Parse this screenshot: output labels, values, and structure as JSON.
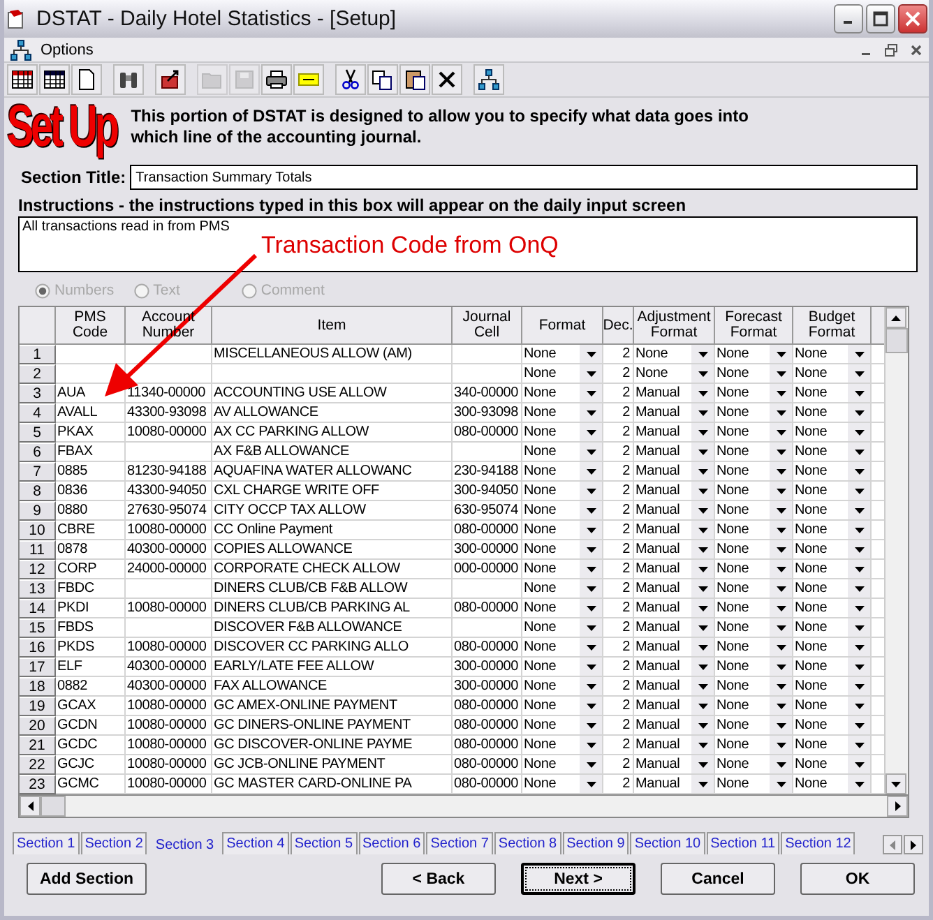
{
  "window": {
    "title": "DSTAT - Daily Hotel Statistics - [Setup]"
  },
  "menu": {
    "label": "Options"
  },
  "toolbar": [
    {
      "kind": "grid-red",
      "disabled": false
    },
    {
      "kind": "grid",
      "disabled": false
    },
    {
      "kind": "page",
      "disabled": false
    },
    {
      "kind": "separator"
    },
    {
      "kind": "binoculars",
      "disabled": false
    },
    {
      "kind": "separator"
    },
    {
      "kind": "export",
      "disabled": false
    },
    {
      "kind": "separator"
    },
    {
      "kind": "folder",
      "disabled": true
    },
    {
      "kind": "save",
      "disabled": true
    },
    {
      "kind": "print",
      "disabled": false
    },
    {
      "kind": "note",
      "disabled": false
    },
    {
      "kind": "separator"
    },
    {
      "kind": "cut",
      "disabled": false
    },
    {
      "kind": "copy",
      "disabled": false
    },
    {
      "kind": "paste",
      "disabled": false
    },
    {
      "kind": "delete",
      "disabled": false
    },
    {
      "kind": "separator"
    },
    {
      "kind": "tree",
      "disabled": false
    }
  ],
  "banner": {
    "logo": "Set Up",
    "text": "This portion of DSTAT is designed to allow you to specify what data goes into which line of the accounting journal."
  },
  "section_title": {
    "label": "Section Title:",
    "value": "Transaction Summary Totals"
  },
  "instructions": {
    "label": "Instructions - the instructions typed in this box will appear on the daily input screen",
    "value": "All transactions read in from PMS"
  },
  "annotation": {
    "text": "Transaction Code from OnQ"
  },
  "value_types": [
    {
      "label": "Numbers",
      "selected": true,
      "disabled": true
    },
    {
      "label": "Text",
      "selected": false,
      "disabled": true
    },
    {
      "label": "Comment",
      "selected": false,
      "disabled": true
    }
  ],
  "table": {
    "columns": [
      {
        "label": "PMS Code",
        "kind": "text"
      },
      {
        "label": "Account Number",
        "kind": "text"
      },
      {
        "label": "Item",
        "kind": "text"
      },
      {
        "label": "Journal Cell",
        "kind": "text"
      },
      {
        "label": "Format",
        "kind": "dropdown"
      },
      {
        "label": "Dec.",
        "kind": "number"
      },
      {
        "label": "Adjustment Format",
        "kind": "dropdown"
      },
      {
        "label": "Forecast Format",
        "kind": "dropdown"
      },
      {
        "label": "Budget Format",
        "kind": "dropdown"
      }
    ],
    "rows": [
      {
        "number": "1",
        "cells": [
          null,
          null,
          "MISCELLANEOUS ALLOW (AM)",
          null,
          "None",
          "2",
          "None",
          "None",
          "None"
        ]
      },
      {
        "number": "2",
        "cells": [
          null,
          null,
          null,
          null,
          "None",
          "2",
          "None",
          "None",
          "None"
        ]
      },
      {
        "number": "3",
        "cells": [
          "AUA",
          "11340-00000",
          "ACCOUNTING USE ALLOW",
          "340-00000",
          "None",
          "2",
          "Manual",
          "None",
          "None"
        ]
      },
      {
        "number": "4",
        "cells": [
          "AVALL",
          "43300-93098",
          "AV ALLOWANCE",
          "300-93098",
          "None",
          "2",
          "Manual",
          "None",
          "None"
        ]
      },
      {
        "number": "5",
        "cells": [
          "PKAX",
          "10080-00000",
          "AX CC PARKING ALLOW",
          "080-00000",
          "None",
          "2",
          "Manual",
          "None",
          "None"
        ]
      },
      {
        "number": "6",
        "cells": [
          "FBAX",
          null,
          "AX F&B ALLOWANCE",
          null,
          "None",
          "2",
          "Manual",
          "None",
          "None"
        ]
      },
      {
        "number": "7",
        "cells": [
          "0885",
          "81230-94188",
          "AQUAFINA WATER ALLOWANC",
          "230-94188",
          "None",
          "2",
          "Manual",
          "None",
          "None"
        ]
      },
      {
        "number": "8",
        "cells": [
          "0836",
          "43300-94050",
          "CXL CHARGE WRITE OFF",
          "300-94050",
          "None",
          "2",
          "Manual",
          "None",
          "None"
        ]
      },
      {
        "number": "9",
        "cells": [
          "0880",
          "27630-95074",
          "CITY OCCP TAX ALLOW",
          "630-95074",
          "None",
          "2",
          "Manual",
          "None",
          "None"
        ]
      },
      {
        "number": "10",
        "cells": [
          "CBRE",
          "10080-00000",
          "CC Online Payment",
          "080-00000",
          "None",
          "2",
          "Manual",
          "None",
          "None"
        ]
      },
      {
        "number": "11",
        "cells": [
          "0878",
          "40300-00000",
          "COPIES ALLOWANCE",
          "300-00000",
          "None",
          "2",
          "Manual",
          "None",
          "None"
        ]
      },
      {
        "number": "12",
        "cells": [
          "CORP",
          "24000-00000",
          "CORPORATE CHECK ALLOW",
          "000-00000",
          "None",
          "2",
          "Manual",
          "None",
          "None"
        ]
      },
      {
        "number": "13",
        "cells": [
          "FBDC",
          null,
          "DINERS CLUB/CB F&B ALLOW",
          null,
          "None",
          "2",
          "Manual",
          "None",
          "None"
        ]
      },
      {
        "number": "14",
        "cells": [
          "PKDI",
          "10080-00000",
          "DINERS CLUB/CB PARKING AL",
          "080-00000",
          "None",
          "2",
          "Manual",
          "None",
          "None"
        ]
      },
      {
        "number": "15",
        "cells": [
          "FBDS",
          null,
          "DISCOVER F&B ALLOWANCE",
          null,
          "None",
          "2",
          "Manual",
          "None",
          "None"
        ]
      },
      {
        "number": "16",
        "cells": [
          "PKDS",
          "10080-00000",
          "DISCOVER CC PARKING ALLO",
          "080-00000",
          "None",
          "2",
          "Manual",
          "None",
          "None"
        ]
      },
      {
        "number": "17",
        "cells": [
          "ELF",
          "40300-00000",
          "EARLY/LATE FEE ALLOW",
          "300-00000",
          "None",
          "2",
          "Manual",
          "None",
          "None"
        ]
      },
      {
        "number": "18",
        "cells": [
          "0882",
          "40300-00000",
          "FAX ALLOWANCE",
          "300-00000",
          "None",
          "2",
          "Manual",
          "None",
          "None"
        ]
      },
      {
        "number": "19",
        "cells": [
          "GCAX",
          "10080-00000",
          "GC AMEX-ONLINE PAYMENT",
          "080-00000",
          "None",
          "2",
          "Manual",
          "None",
          "None"
        ]
      },
      {
        "number": "20",
        "cells": [
          "GCDN",
          "10080-00000",
          "GC DINERS-ONLINE PAYMENT",
          "080-00000",
          "None",
          "2",
          "Manual",
          "None",
          "None"
        ]
      },
      {
        "number": "21",
        "cells": [
          "GCDC",
          "10080-00000",
          "GC DISCOVER-ONLINE PAYME",
          "080-00000",
          "None",
          "2",
          "Manual",
          "None",
          "None"
        ]
      },
      {
        "number": "22",
        "cells": [
          "GCJC",
          "10080-00000",
          "GC JCB-ONLINE PAYMENT",
          "080-00000",
          "None",
          "2",
          "Manual",
          "None",
          "None"
        ]
      },
      {
        "number": "23",
        "cells": [
          "GCMC",
          "10080-00000",
          "GC MASTER CARD-ONLINE PA",
          "080-00000",
          "None",
          "2",
          "Manual",
          "None",
          "None"
        ]
      }
    ]
  },
  "tabs": [
    {
      "label": "Section 1",
      "selected": false
    },
    {
      "label": "Section 2",
      "selected": false
    },
    {
      "label": "Section 3",
      "selected": true
    },
    {
      "label": "Section 4",
      "selected": false
    },
    {
      "label": "Section 5",
      "selected": false
    },
    {
      "label": "Section 6",
      "selected": false
    },
    {
      "label": "Section 7",
      "selected": false
    },
    {
      "label": "Section 8",
      "selected": false
    },
    {
      "label": "Section 9",
      "selected": false
    },
    {
      "label": "Section 10",
      "selected": false
    },
    {
      "label": "Section 11",
      "selected": false
    },
    {
      "label": "Section 12",
      "selected": false
    }
  ],
  "buttons": [
    {
      "label": "Add Section",
      "focused": false
    },
    {
      "label": "< Back",
      "focused": false
    },
    {
      "label": "Next >",
      "focused": true
    },
    {
      "label": "Cancel",
      "focused": false
    },
    {
      "label": "OK",
      "focused": false
    }
  ]
}
